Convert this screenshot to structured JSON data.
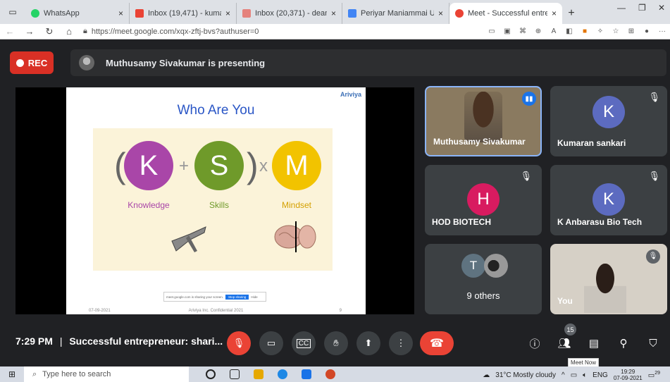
{
  "browser": {
    "tabs": [
      {
        "title": "WhatsApp",
        "icon": "whatsapp-icon",
        "color": "#25d366"
      },
      {
        "title": "Inbox (19,471) - kumarans@",
        "icon": "gmail-icon",
        "color": "#ea4335"
      },
      {
        "title": "Inbox (20,371) - deanresearc",
        "icon": "gmail-icon",
        "color": "#ea4335"
      },
      {
        "title": "Periyar Maniammai Universit",
        "icon": "page-icon",
        "color": "#4285f4"
      },
      {
        "title": "Meet - Successful entre",
        "icon": "meet-icon",
        "color": "#ea4335"
      }
    ],
    "url": "https://meet.google.com/xqx-zftj-bvs?authuser=0"
  },
  "meet": {
    "rec_label": "REC",
    "presenting_text": "Muthusamy Sivakumar is presenting",
    "slide": {
      "brand": "Ariviya",
      "title": "Who Are You",
      "items": [
        {
          "letter": "K",
          "label": "Knowledge",
          "color": "#a946a8"
        },
        {
          "letter": "S",
          "label": "Skills",
          "color": "#6f9a2a"
        },
        {
          "letter": "M",
          "label": "Mindset",
          "color": "#f2c300"
        }
      ],
      "operators": [
        "+",
        "x"
      ],
      "share_text": "meet.google.com is sharing your screen.",
      "share_stop": "Stop sharing",
      "share_hide": "Hide",
      "date": "07-09-2021",
      "footer": "Ariviya Inc. Confidential 2021",
      "page": "9"
    },
    "participants": [
      {
        "name": "Muthusamy Sivakumar",
        "type": "video"
      },
      {
        "name": "Kumaran sankari",
        "initial": "K",
        "color": "#5c6bc0"
      },
      {
        "name": "HOD BIOTECH",
        "initial": "H",
        "color": "#d81b60"
      },
      {
        "name": "K Anbarasu Bio Tech",
        "initial": "K",
        "color": "#5c6bc0"
      },
      {
        "name": "9 others",
        "initial": "T"
      },
      {
        "name": "You",
        "type": "video"
      }
    ],
    "time": "7:29 PM",
    "meeting_title": "Successful entrepreneur: shari...",
    "people_count": "15",
    "tooltip": "Meet Now"
  },
  "taskbar": {
    "search_placeholder": "Type here to search",
    "weather": "31°C  Mostly cloudy",
    "lang": "ENG",
    "time": "19:29",
    "date": "07-09-2021",
    "notif": "29"
  }
}
